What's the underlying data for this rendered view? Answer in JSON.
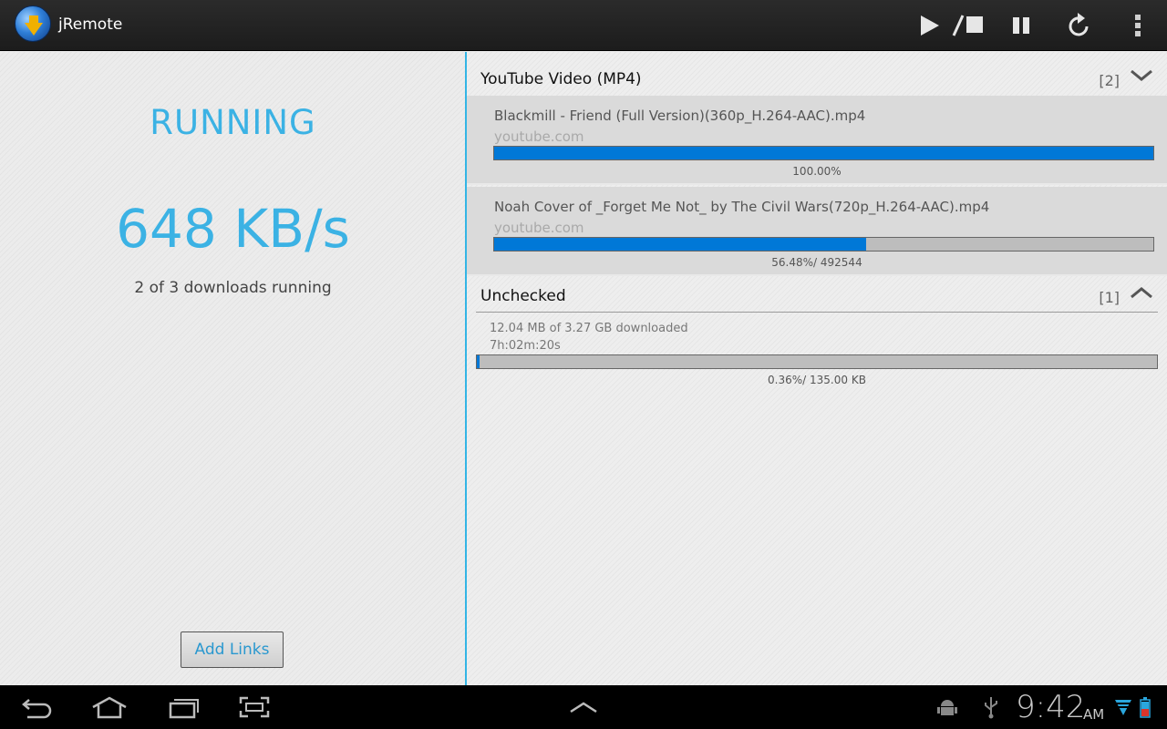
{
  "app": {
    "title": "jRemote",
    "icon": "jdownloader-globe-icon"
  },
  "toolbar": {
    "actions": [
      {
        "name": "play-stop",
        "icon": "play-stop-icon"
      },
      {
        "name": "pause",
        "icon": "pause-icon"
      },
      {
        "name": "refresh",
        "icon": "refresh-icon"
      },
      {
        "name": "overflow-menu",
        "icon": "more-vert-icon"
      }
    ]
  },
  "status": {
    "state": "RUNNING",
    "speed": "648 KB/s",
    "downloads_running": "2 of 3 downloads running"
  },
  "add_links_label": "Add Links",
  "groups": [
    {
      "title": "YouTube Video (MP4)",
      "count": "[2]",
      "expanded": true,
      "items": [
        {
          "name": "Blackmill - Friend (Full Version)(360p_H.264-AAC).mp4",
          "host": "youtube.com",
          "progress": 1.0,
          "progress_text": "100.00%"
        },
        {
          "name": "Noah Cover of _Forget Me Not_ by The Civil Wars(720p_H.264-AAC).mp4",
          "host": "youtube.com",
          "progress": 0.5648,
          "progress_text": "56.48%/ 492544"
        }
      ]
    },
    {
      "title": "Unchecked",
      "count": "[1]",
      "expanded": false,
      "summary": {
        "downloaded": "12.04 MB of 3.27 GB downloaded",
        "eta": "7h:02m:20s",
        "progress": 0.0036,
        "progress_text": "0.36%/ 135.00 KB"
      }
    }
  ],
  "system_bar": {
    "time": "9:42",
    "ampm": "AM"
  },
  "colors": {
    "accent": "#33b5e5",
    "status_text": "#3bb2e4",
    "progress_fill": "#0078d7"
  }
}
